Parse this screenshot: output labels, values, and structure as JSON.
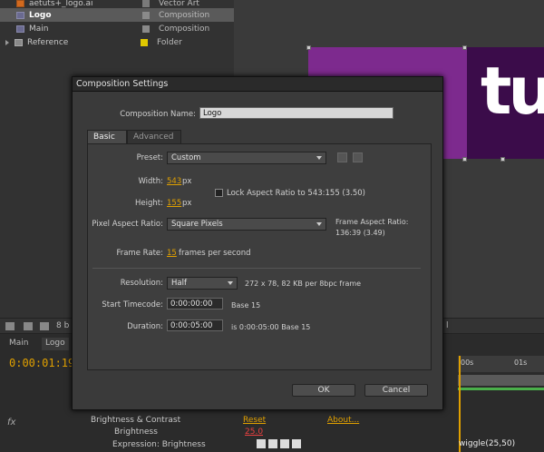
{
  "project": {
    "rows": [
      {
        "name": "aetuts+_logo.ai",
        "type": "Vector Art",
        "swatch": "#7a7a7a"
      },
      {
        "name": "Logo",
        "type": "Composition",
        "swatch": "#8a8a8a"
      },
      {
        "name": "Main",
        "type": "Composition",
        "swatch": "#8a8a8a"
      },
      {
        "name": "Reference",
        "type": "Folder",
        "swatch": "#e0c800"
      }
    ],
    "bpc_label": "8 b",
    "right_label": "l"
  },
  "viewer": {
    "text": "tu"
  },
  "timeline": {
    "tabs": [
      "Main",
      "Logo"
    ],
    "timecode": "0:00:01:19",
    "ruler": [
      "00s",
      "01s"
    ],
    "effect": {
      "name": "Brightness & Contrast",
      "reset": "Reset",
      "about": "About..."
    },
    "property": {
      "name": "Brightness",
      "value": "25.0"
    },
    "expression_label": "Expression: Brightness",
    "expression_code": "wiggle(25,50)",
    "fx_icon": "fx"
  },
  "dialog": {
    "title": "Composition Settings",
    "comp_name_label": "Composition Name:",
    "comp_name_value": "Logo",
    "tabs": {
      "basic": "Basic",
      "advanced": "Advanced"
    },
    "preset_label": "Preset:",
    "preset_value": "Custom",
    "width_label": "Width:",
    "width_value": "543",
    "height_label": "Height:",
    "height_value": "155",
    "px": "px",
    "lock_aspect_label": "Lock Aspect Ratio to 543:155 (3.50)",
    "par_label": "Pixel Aspect Ratio:",
    "par_value": "Square Pixels",
    "frame_aspect_label": "Frame Aspect Ratio:",
    "frame_aspect_value": "136:39 (3.49)",
    "frame_rate_label": "Frame Rate:",
    "frame_rate_value": "15",
    "frame_rate_unit": "frames per second",
    "resolution_label": "Resolution:",
    "resolution_value": "Half",
    "resolution_info": "272 x 78, 82 KB per 8bpc frame",
    "start_tc_label": "Start Timecode:",
    "start_tc_value": "0:00:00:00",
    "start_tc_base": "Base 15",
    "duration_label": "Duration:",
    "duration_value": "0:00:05:00",
    "duration_info": "is 0:00:05:00  Base 15",
    "ok_label": "OK",
    "cancel_label": "Cancel"
  }
}
